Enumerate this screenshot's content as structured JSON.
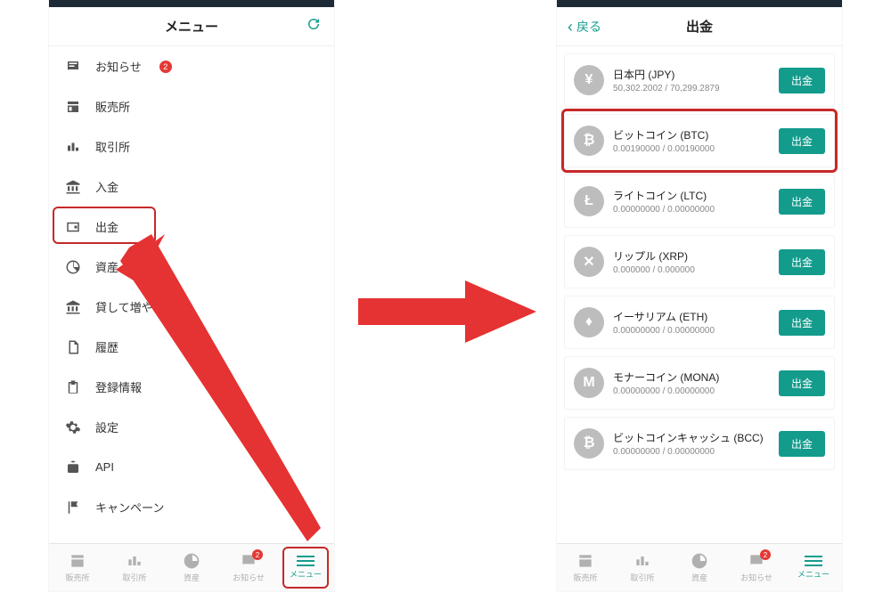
{
  "left": {
    "header": {
      "title": "メニュー",
      "refresh": "refresh"
    },
    "menu": [
      {
        "label": "お知らせ",
        "badge": "2"
      },
      {
        "label": "販売所"
      },
      {
        "label": "取引所"
      },
      {
        "label": "入金"
      },
      {
        "label": "出金",
        "highlighted": true
      },
      {
        "label": "資産"
      },
      {
        "label": "貸して増やす"
      },
      {
        "label": "履歴"
      },
      {
        "label": "登録情報"
      },
      {
        "label": "設定"
      },
      {
        "label": "API"
      },
      {
        "label": "キャンペーン"
      }
    ]
  },
  "right": {
    "header": {
      "back": "戻る",
      "title": "出金"
    },
    "assets": [
      {
        "symbol": "¥",
        "name": "日本円 (JPY)",
        "balance": "50,302.2002 / 70,299.2879",
        "action": "出金"
      },
      {
        "symbol": "₿",
        "name": "ビットコイン (BTC)",
        "balance": "0.00190000 / 0.00190000",
        "action": "出金",
        "highlighted": true
      },
      {
        "symbol": "Ł",
        "name": "ライトコイン (LTC)",
        "balance": "0.00000000 / 0.00000000",
        "action": "出金"
      },
      {
        "symbol": "✕",
        "name": "リップル (XRP)",
        "balance": "0.000000 / 0.000000",
        "action": "出金"
      },
      {
        "symbol": "♦",
        "name": "イーサリアム (ETH)",
        "balance": "0.00000000 / 0.00000000",
        "action": "出金"
      },
      {
        "symbol": "M",
        "name": "モナーコイン (MONA)",
        "balance": "0.00000000 / 0.00000000",
        "action": "出金"
      },
      {
        "symbol": "₿",
        "name": "ビットコインキャッシュ (BCC)",
        "balance": "0.00000000 / 0.00000000",
        "action": "出金"
      }
    ]
  },
  "tabbar": {
    "items": [
      {
        "label": "販売所"
      },
      {
        "label": "取引所"
      },
      {
        "label": "資産"
      },
      {
        "label": "お知らせ",
        "badge": "2"
      },
      {
        "label": "メニュー",
        "active": true
      }
    ]
  }
}
